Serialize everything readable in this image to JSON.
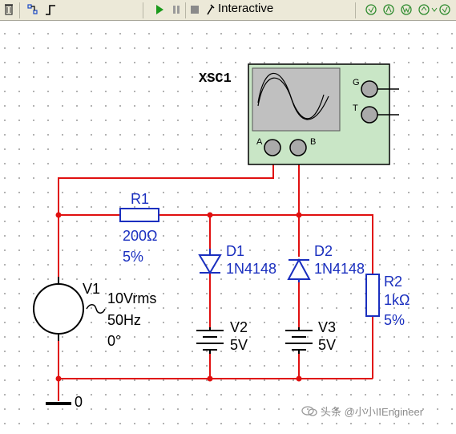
{
  "toolbar": {
    "mode_label": "Interactive"
  },
  "oscilloscope": {
    "name": "XSC1",
    "terminal_g": "G",
    "terminal_t": "T",
    "terminal_a": "A",
    "terminal_b": "B"
  },
  "r1": {
    "name": "R1",
    "value": "200Ω",
    "tolerance": "5%"
  },
  "r2": {
    "name": "R2",
    "value": "1kΩ",
    "tolerance": "5%"
  },
  "d1": {
    "name": "D1",
    "model": "1N4148"
  },
  "d2": {
    "name": "D2",
    "model": "1N4148"
  },
  "v1": {
    "name": "V1",
    "amplitude": "10Vrms",
    "frequency": "50Hz",
    "phase": "0°"
  },
  "v2": {
    "name": "V2",
    "value": "5V"
  },
  "v3": {
    "name": "V3",
    "value": "5V"
  },
  "ground": {
    "label": "0"
  },
  "watermark": {
    "text": "头条 @小小IIEngineer"
  },
  "colors": {
    "wire": "#e01010",
    "component": "#1a2fbf",
    "label": "#1a2fbf",
    "scope_body": "#c9e6c6",
    "scope_screen": "#c0c0c0"
  }
}
